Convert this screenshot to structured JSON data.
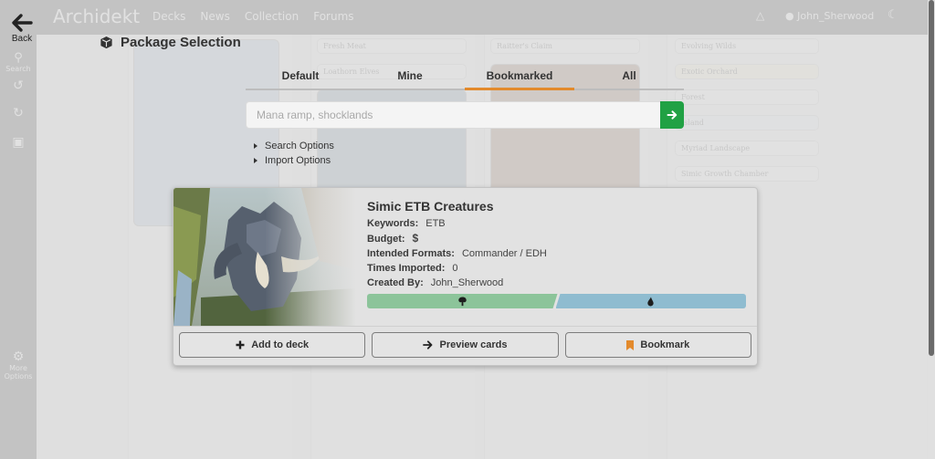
{
  "background": {
    "app_name": "Archidekt",
    "nav": [
      "Decks",
      "News",
      "Collection",
      "Forums"
    ],
    "username": "John_Sherwood",
    "sidebar_items": [
      "Search",
      "More Options"
    ],
    "card_names": [
      "Fresh Meat",
      "Raitter's Claim",
      "Evolving Wilds",
      "Loathorn Elves",
      "Exotic Orchard",
      "Forest",
      "Island",
      "Myriad Landscape",
      "Simic Growth Chamber"
    ]
  },
  "back": {
    "label": "Back",
    "icon": "arrow-left-icon"
  },
  "modal": {
    "title": "Package Selection",
    "title_icon": "cube-icon",
    "tabs": [
      {
        "label": "Default",
        "active": false
      },
      {
        "label": "Mine",
        "active": false
      },
      {
        "label": "Bookmarked",
        "active": true
      },
      {
        "label": "All",
        "active": false
      }
    ],
    "search": {
      "value": "",
      "placeholder": "Mana ramp, shocklands",
      "submit_icon": "arrow-right-icon"
    },
    "options": [
      "Search Options",
      "Import Options"
    ]
  },
  "package": {
    "name": "Simic ETB Creatures",
    "fields": [
      {
        "key": "Keywords:",
        "value": "ETB"
      },
      {
        "key": "Budget:",
        "value": "$"
      },
      {
        "key": "Intended Formats:",
        "value": "Commander / EDH"
      },
      {
        "key": "Times Imported:",
        "value": "0"
      },
      {
        "key": "Created By:",
        "value": "John_Sherwood"
      }
    ],
    "colors": [
      {
        "name": "green",
        "icon": "tree-icon",
        "hex": "#8cc49a"
      },
      {
        "name": "blue",
        "icon": "water-drop-icon",
        "hex": "#8fbcd0"
      }
    ],
    "actions": {
      "add": "Add to deck",
      "preview": "Preview cards",
      "bookmark": "Bookmark"
    },
    "bookmark_color": "#e38a2c"
  },
  "colors": {
    "accent_tab": "#e38a2c",
    "search_button": "#21a144"
  }
}
